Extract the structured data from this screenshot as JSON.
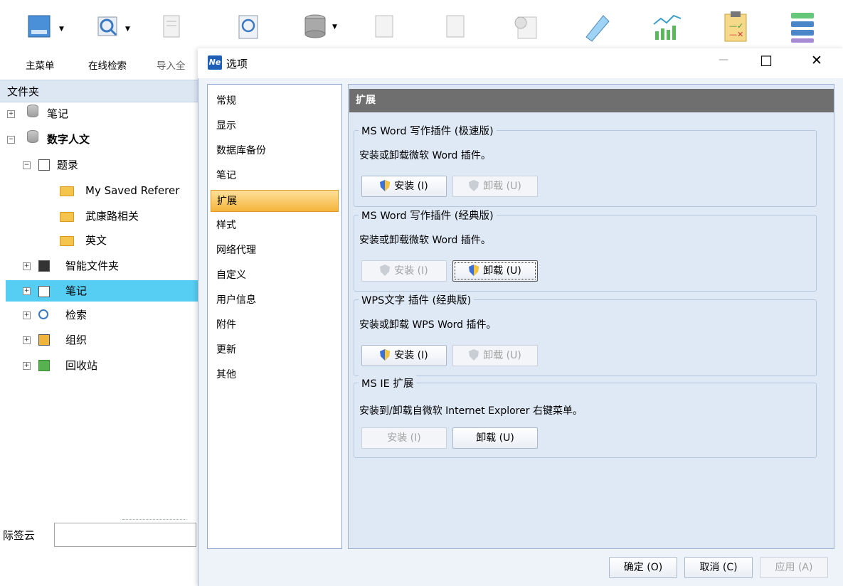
{
  "toolbar": {
    "items": [
      {
        "label": "主菜单",
        "icon": "main-menu-icon"
      },
      {
        "label": "在线检索",
        "icon": "online-search-icon"
      },
      {
        "label": "导入全",
        "icon": "import-fulltext-icon"
      },
      {
        "label": "",
        "icon": "search-document-icon"
      },
      {
        "label": "",
        "icon": "database-icon"
      },
      {
        "label": "",
        "icon": "document-icon"
      },
      {
        "label": "",
        "icon": "export-icon"
      },
      {
        "label": "",
        "icon": "word-icon"
      },
      {
        "label": "",
        "icon": "tag-icon"
      },
      {
        "label": "",
        "icon": "analytics-chart-icon"
      },
      {
        "label": "",
        "icon": "checklist-icon"
      },
      {
        "label": "",
        "icon": "mindmap-icon"
      }
    ]
  },
  "left": {
    "folders_header": "文件夹",
    "tree": [
      {
        "label": "笔记",
        "expander": "+",
        "icon": "database-icon",
        "bold": false
      },
      {
        "label": "数字人文",
        "expander": "-",
        "icon": "database-icon",
        "bold": true
      },
      {
        "label": "题录",
        "expander": "-",
        "icon": "list-icon"
      },
      {
        "label": "My Saved Referer",
        "icon": "folder-icon"
      },
      {
        "label": "武康路相关",
        "icon": "folder-icon"
      },
      {
        "label": "英文",
        "icon": "folder-icon"
      },
      {
        "label": "智能文件夹",
        "expander": "+",
        "icon": "smart-folder-icon"
      },
      {
        "label": "笔记",
        "expander": "+",
        "icon": "notes-icon",
        "selected": true
      },
      {
        "label": "检索",
        "expander": "+",
        "icon": "search-icon"
      },
      {
        "label": "组织",
        "expander": "+",
        "icon": "organize-icon"
      },
      {
        "label": "回收站",
        "expander": "+",
        "icon": "recycle-bin-icon"
      }
    ],
    "tag_cloud_label": "际签云"
  },
  "dialog": {
    "title": "选项",
    "app_badge": "Ne",
    "nav": [
      "常规",
      "显示",
      "数据库备份",
      "笔记",
      "扩展",
      "样式",
      "网络代理",
      "自定义",
      "用户信息",
      "附件",
      "更新",
      "其他"
    ],
    "selected_nav": "扩展",
    "section_title": "扩展",
    "groups": [
      {
        "title": "MS Word 写作插件 (极速版)",
        "desc": "安装或卸载微软 Word 插件。",
        "install": "安装 (I)",
        "uninstall": "卸载 (U)"
      },
      {
        "title": "MS Word 写作插件 (经典版)",
        "desc": "安装或卸载微软 Word 插件。",
        "install": "安装 (I)",
        "uninstall": "卸载 (U)"
      },
      {
        "title": "WPS文字 插件 (经典版)",
        "desc": "安装或卸载 WPS Word 插件。",
        "install": "安装 (I)",
        "uninstall": "卸载 (U)"
      },
      {
        "title": "MS IE 扩展",
        "desc": "安装到/卸载自微软 Internet Explorer 右键菜单。",
        "install": "安装 (I)",
        "uninstall": "卸载 (U)"
      }
    ],
    "footer": {
      "ok": "确定 (O)",
      "cancel": "取消 (C)",
      "apply": "应用 (A)"
    },
    "window_controls": {
      "minimize": "—",
      "maximize": "☐",
      "close": "✕"
    }
  },
  "colors": {
    "accent_orange": "#f5b43b",
    "header_gray": "#6f6f6f",
    "selected_blue": "#56cdf2"
  }
}
